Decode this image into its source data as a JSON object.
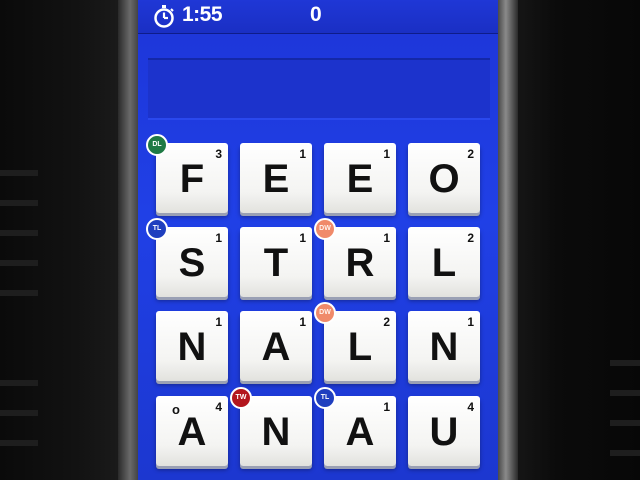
{
  "status": {
    "timer": "1:55",
    "score": "0",
    "timer_icon": "stopwatch-icon"
  },
  "word": "",
  "colors": {
    "screen": "#2040e6",
    "tile": "#f4f4f2",
    "dl": "#1f7a45",
    "tl": "#1f3fbf",
    "tw": "#b3161e",
    "dw": "#f08a6a"
  },
  "tiles": [
    {
      "letter": "F",
      "points": "3"
    },
    {
      "letter": "E",
      "points": "1"
    },
    {
      "letter": "E",
      "points": "1"
    },
    {
      "letter": "O",
      "points": "2"
    },
    {
      "letter": "S",
      "points": "1"
    },
    {
      "letter": "T",
      "points": "1"
    },
    {
      "letter": "R",
      "points": "1"
    },
    {
      "letter": "L",
      "points": "2"
    },
    {
      "letter": "N",
      "points": "1"
    },
    {
      "letter": "A",
      "points": "1"
    },
    {
      "letter": "L",
      "points": "2"
    },
    {
      "letter": "N",
      "points": "1"
    },
    {
      "letter": "A",
      "points": "4",
      "ring": "o"
    },
    {
      "letter": "N",
      "points": ""
    },
    {
      "letter": "A",
      "points": "1"
    },
    {
      "letter": "U",
      "points": "4"
    }
  ],
  "bonuses": [
    {
      "tile": 0,
      "label": "DL",
      "kind": "dl"
    },
    {
      "tile": 4,
      "label": "TL",
      "kind": "tl"
    },
    {
      "tile": 6,
      "label": "DW",
      "kind": "dw"
    },
    {
      "tile": 10,
      "label": "DW",
      "kind": "dw"
    },
    {
      "tile": 13,
      "label": "TW",
      "kind": "tw"
    },
    {
      "tile": 14,
      "label": "TL",
      "kind": "tl"
    }
  ]
}
